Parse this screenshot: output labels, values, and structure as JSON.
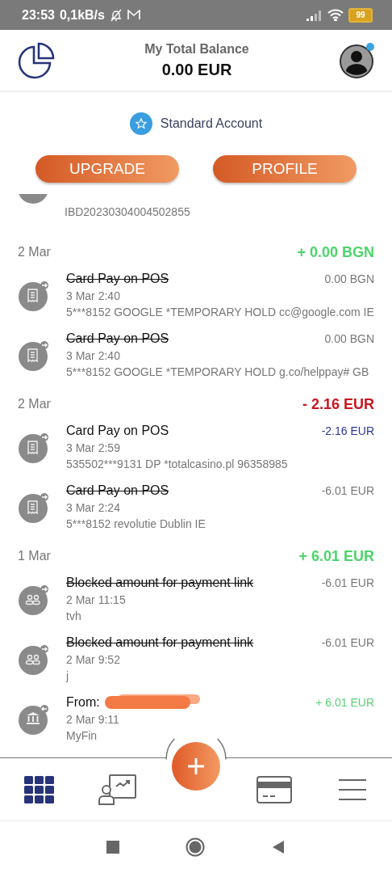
{
  "status_bar": {
    "time": "23:53",
    "speed": "0,1kB/s",
    "battery": "99"
  },
  "header": {
    "title": "My Total Balance",
    "balance": "0.00 EUR"
  },
  "account": {
    "label": "Standard Account"
  },
  "buttons": [
    "UPGRADE",
    "PROFILE"
  ],
  "partial_item": {
    "detail": "IBD20230304004502855"
  },
  "groups": [
    {
      "date": "2 Mar",
      "total": "+ 0.00 BGN",
      "positive": true,
      "items": [
        {
          "kind": "receipt",
          "incoming": false,
          "title": "Card Pay on POS",
          "cancelled": true,
          "datetime": "3 Mar 2:40",
          "detail": "5***8152 GOOGLE *TEMPORARY HOLD cc@google.com IE",
          "amount": "0.00 BGN"
        },
        {
          "kind": "receipt",
          "incoming": false,
          "title": "Card Pay on POS",
          "cancelled": true,
          "datetime": "3 Mar 2:40",
          "detail": "5***8152 GOOGLE *TEMPORARY HOLD g.co/helppay# GB",
          "amount": "0.00 BGN"
        }
      ]
    },
    {
      "date": "2 Mar",
      "total": "- 2.16 EUR",
      "positive": false,
      "items": [
        {
          "kind": "receipt",
          "incoming": false,
          "title": "Card Pay on POS",
          "cancelled": false,
          "datetime": "3 Mar 2:59",
          "detail": "535502***9131 DP *totalcasino.pl 96358985",
          "amount": "-2.16 EUR"
        },
        {
          "kind": "receipt",
          "incoming": false,
          "title": "Card Pay on POS",
          "cancelled": true,
          "datetime": "3 Mar 2:24",
          "detail": "5***8152 revolutie Dublin IE",
          "amount": "-6.01 EUR"
        }
      ]
    },
    {
      "date": "1 Mar",
      "total": "+ 6.01 EUR",
      "positive": true,
      "items": [
        {
          "kind": "people",
          "incoming": false,
          "title": "Blocked amount for payment link",
          "cancelled": true,
          "datetime": "2 Mar 11:15",
          "detail": "tvh",
          "amount": "-6.01 EUR"
        },
        {
          "kind": "people",
          "incoming": false,
          "title": "Blocked amount for payment link",
          "cancelled": true,
          "datetime": "2 Mar 9:52",
          "detail": "j",
          "amount": "-6.01 EUR"
        },
        {
          "kind": "bank",
          "incoming": true,
          "title": "From:",
          "cancelled": false,
          "redacted": true,
          "datetime": "2 Mar 9:11",
          "detail": "MyFin",
          "amount": "+ 6.01 EUR"
        }
      ]
    }
  ],
  "nav": [
    {
      "kind": "grid",
      "selected": true
    },
    {
      "kind": "presentation",
      "selected": false
    },
    {
      "kind": "add",
      "selected": false
    },
    {
      "kind": "card",
      "selected": false
    },
    {
      "kind": "menu",
      "selected": false
    }
  ]
}
